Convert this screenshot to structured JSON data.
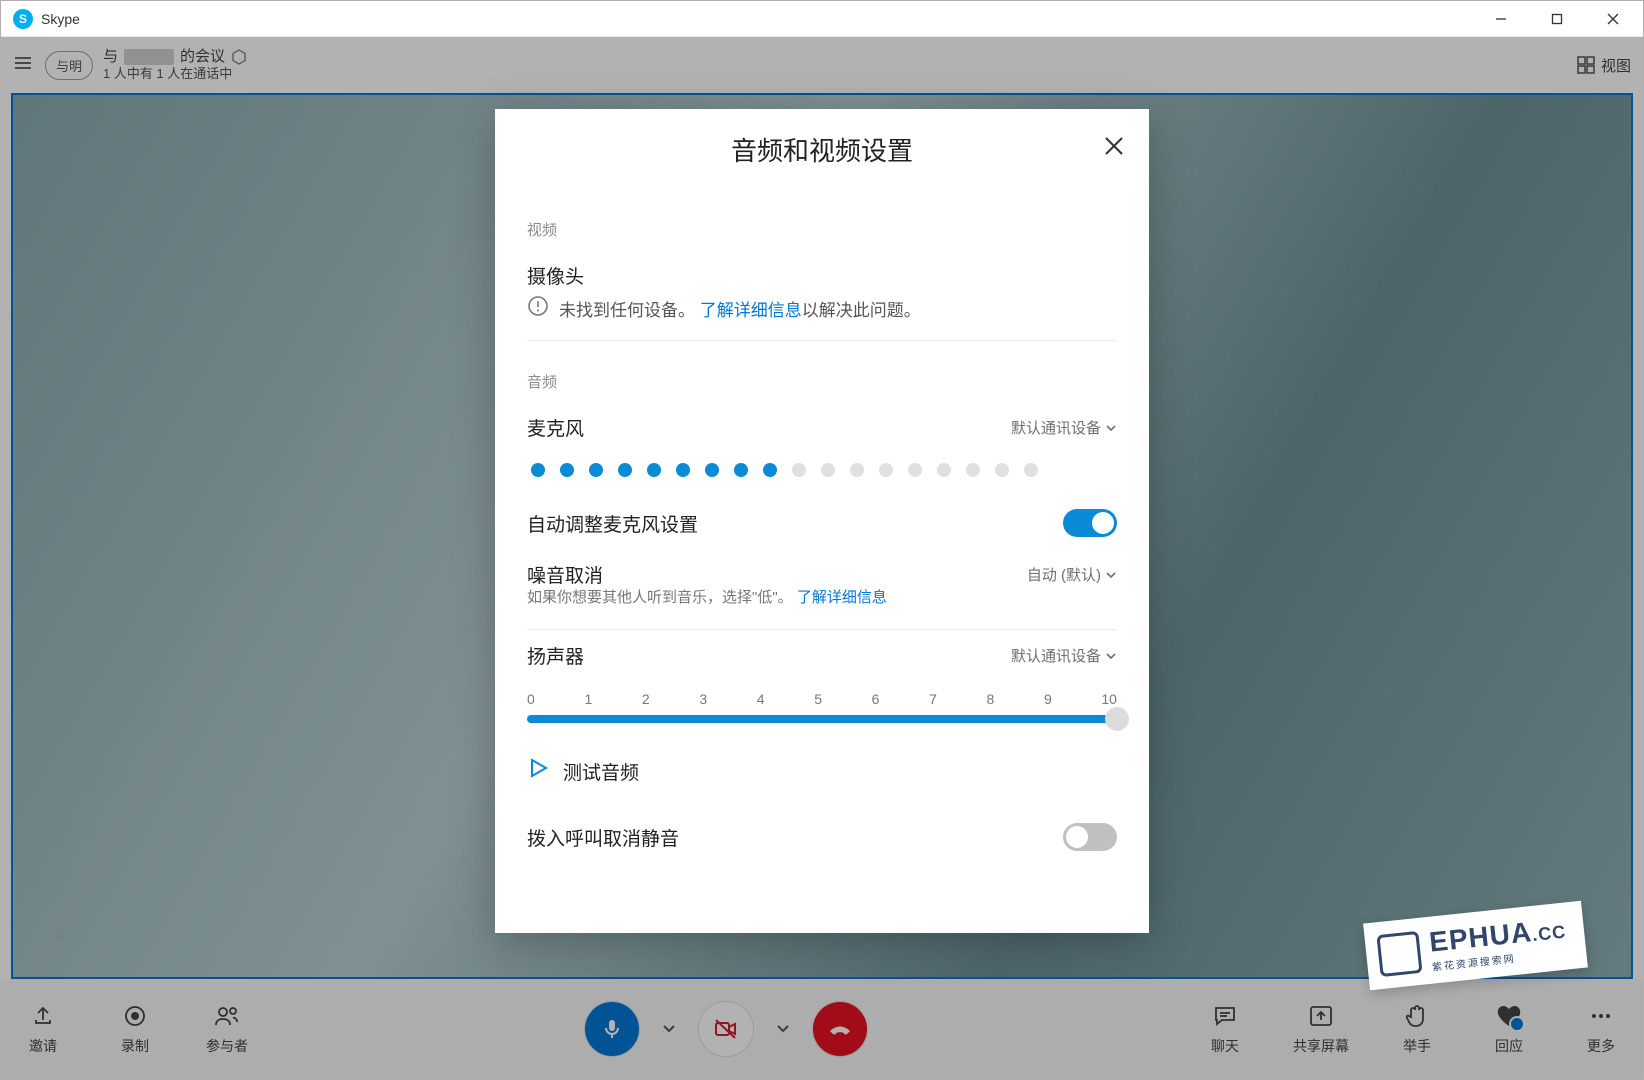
{
  "app": {
    "name": "Skype"
  },
  "header": {
    "avatar_label": "与明",
    "title_suffix": "的会议",
    "title_prefix": "与",
    "subtitle": "1 人中有 1 人在通话中",
    "view_label": "视图"
  },
  "bottombar": {
    "left": {
      "invite": "邀请",
      "record": "录制",
      "participants": "参与者"
    },
    "right": {
      "chat": "聊天",
      "share": "共享屏幕",
      "raise": "举手",
      "react": "回应",
      "more": "更多"
    }
  },
  "modal": {
    "title": "音频和视频设置",
    "video_section": "视频",
    "camera_label": "摄像头",
    "camera_err": "未找到任何设备。",
    "camera_link": "了解详细信息",
    "camera_err_tail": "以解决此问题。",
    "audio_section": "音频",
    "mic_label": "麦克风",
    "mic_device": "默认通讯设备",
    "mic_level_active": 9,
    "mic_level_total": 18,
    "auto_mic_label": "自动调整麦克风设置",
    "auto_mic_on": true,
    "noise_label": "噪音取消",
    "noise_value": "自动 (默认)",
    "noise_desc_pre": "如果你想要其他人听到音乐，选择\"低\"。",
    "noise_desc_link": "了解详细信息",
    "speaker_label": "扬声器",
    "speaker_device": "默认通讯设备",
    "speaker_ticks": [
      "0",
      "1",
      "2",
      "3",
      "4",
      "5",
      "6",
      "7",
      "8",
      "9",
      "10"
    ],
    "speaker_value": 10,
    "test_audio": "测试音频",
    "unmute_dialin": "拨入呼叫取消静音",
    "unmute_dialin_on": false
  },
  "watermark": {
    "text": "EPHUA",
    "domain": ".CC",
    "sub": "紫花资源搜索网"
  }
}
